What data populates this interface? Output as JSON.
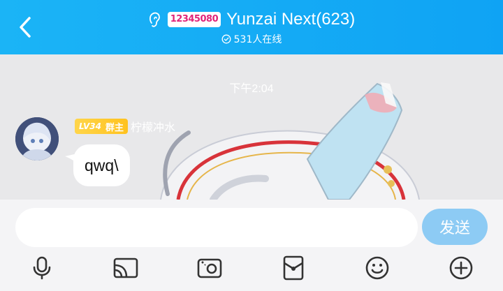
{
  "header": {
    "group_logo_text": "12345080",
    "title": "Yunzai Next(623)",
    "online_text": "531人在线"
  },
  "chat": {
    "timestamp": "下午2:04",
    "message": {
      "level": "LV34",
      "role": "群主",
      "sender": "柠檬冲水",
      "text": "qwq\\"
    }
  },
  "input": {
    "value": "",
    "send_label": "发送"
  },
  "toolbar": {
    "icons": [
      "microphone-icon",
      "screen-cast-icon",
      "photo-icon",
      "red-packet-icon",
      "emoji-icon",
      "plus-icon"
    ]
  },
  "colors": {
    "header": "#1bb4f6",
    "send_button": "#8dcbf4",
    "badge": "#ffc21f"
  }
}
